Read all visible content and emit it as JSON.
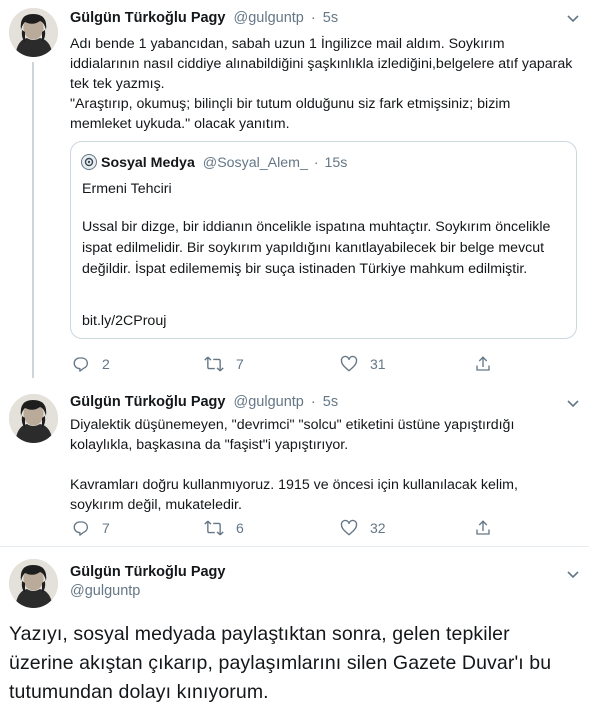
{
  "tweet1": {
    "name": "Gülgün Türkoğlu Pagy",
    "handle": "@gulguntp",
    "dot": "·",
    "time": "5s",
    "text": "Adı bende 1 yabancıdan, sabah uzun 1 İngilizce mail aldım. Soykırım iddialarının nasıl ciddiye alınabildiğini şaşkınlıkla izlediğini,belgelere atıf yaparak tek tek yazmış.\n\"Araştırıp, okumuş; bilinçli bir tutum olduğunu siz fark etmişsiniz; bizim memleket uykuda.\" olacak yanıtım.",
    "quote": {
      "name": "Sosyal Medya",
      "handle": "@Sosyal_Alem_",
      "dot": "·",
      "time": "15s",
      "title": "Ermeni Tehciri",
      "body": "Ussal bir dizge, bir iddianın öncelikle ispatına muhtaçtır. Soykırım öncelikle ispat edilmelidir. Bir soykırım yapıldığını kanıtlayabilecek bir belge mevcut değildir. İspat edilememiş bir suça istinaden Türkiye mahkum edilmiştir.",
      "link": "bit.ly/2CProuj"
    },
    "replies": "2",
    "retweets": "7",
    "likes": "31"
  },
  "tweet2": {
    "name": "Gülgün Türkoğlu Pagy",
    "handle": "@gulguntp",
    "dot": "·",
    "time": "5s",
    "text": "Diyalektik düşünemeyen, \"devrimci\" \"solcu\" etiketini üstüne yapıştırdığı kolaylıkla, başkasına da \"faşist\"i yapıştırıyor.\n\nKavramları doğru kullanmıyoruz. 1915 ve öncesi için kullanılacak kelim, soykırım değil, mukateledir.",
    "replies": "7",
    "retweets": "6",
    "likes": "32"
  },
  "tweet3": {
    "name": "Gülgün Türkoğlu Pagy",
    "handle": "@gulguntp",
    "text": "Yazıyı, sosyal medyada paylaştıktan sonra, gelen tepkiler üzerine akıştan çıkarıp, paylaşımlarını silen Gazete Duvar'ı bu tutumundan dolayı kınıyorum."
  },
  "icons": {
    "reply": "reply-icon",
    "retweet": "retweet-icon",
    "like": "heart-icon",
    "share": "share-icon",
    "caret": "chevron-down-icon"
  },
  "colors": {
    "text": "#14171a",
    "muted": "#657786",
    "border": "#ccd6dd"
  }
}
